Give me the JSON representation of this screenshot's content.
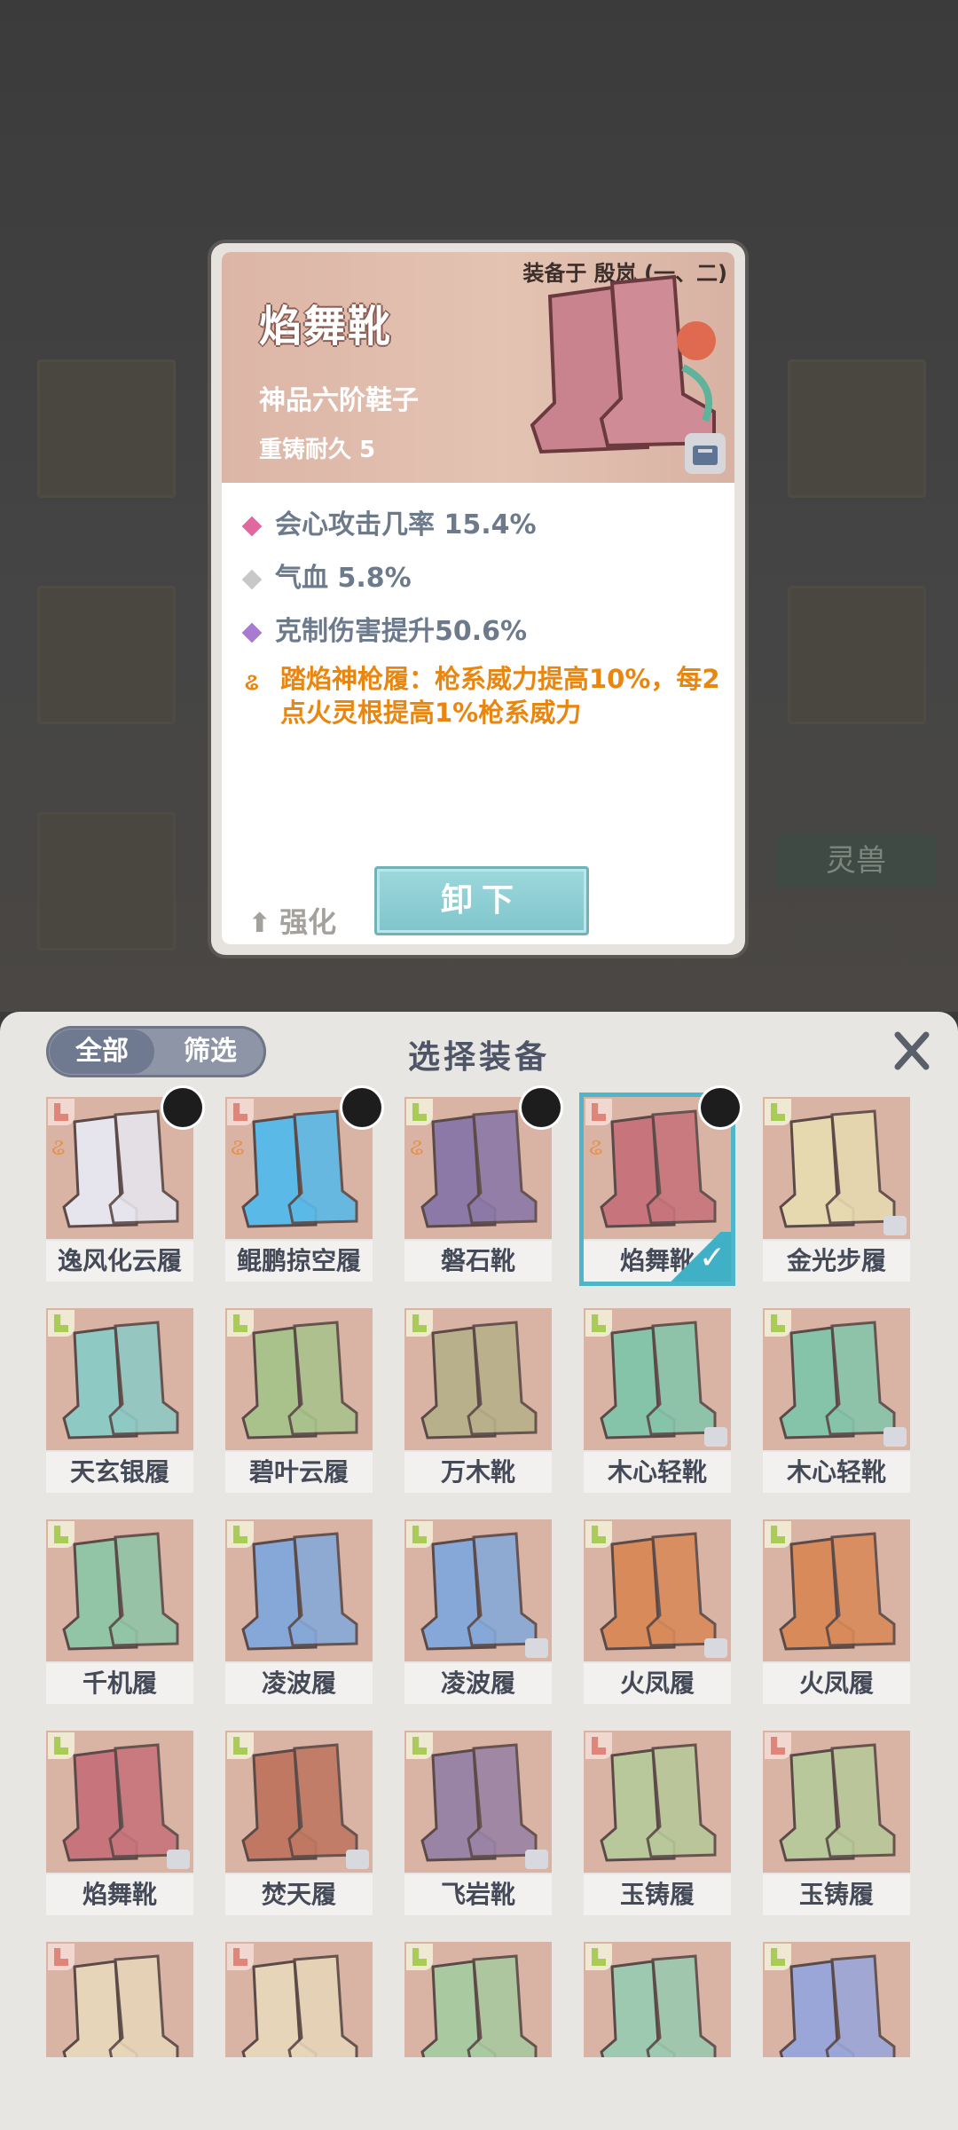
{
  "detail": {
    "equipped_text": "装备于 殷岚 (一、二)",
    "name": "焰舞靴",
    "grade": "神品六阶鞋子",
    "recast": "重铸耐久 5",
    "stats": [
      {
        "text": "会心攻击几率 15.4%",
        "color": "#e0689f"
      },
      {
        "text": "气血 5.8%",
        "color": "#c8c8c8"
      },
      {
        "text": "克制伤害提升50.6%",
        "color": "#a87ad0"
      }
    ],
    "special_icon": "rare-mark-icon",
    "special_text": "踏焰神枪履：枪系威力提高10%，每2点火灵根提高1%枪系威力",
    "strengthen_label": "强化",
    "unequip_label": "卸下"
  },
  "background": {
    "pet_label": "灵兽"
  },
  "panel": {
    "filter_all": "全部",
    "filter_select": "筛选",
    "title": "选择装备",
    "close_icon": "close-icon"
  },
  "items": [
    {
      "name": "逸风化云履",
      "color": "#e6e4ec",
      "tag": "red",
      "rare": true,
      "face": true
    },
    {
      "name": "鲲鹏掠空履",
      "color": "#5bb9e8",
      "tag": "red",
      "rare": true,
      "face": true
    },
    {
      "name": "磐石靴",
      "color": "#8c79a8",
      "tag": "yellow",
      "rare": true,
      "face": true
    },
    {
      "name": "焰舞靴",
      "color": "#c8747c",
      "tag": "red",
      "rare": true,
      "face": true,
      "selected": true,
      "lock": true
    },
    {
      "name": "金光步履",
      "color": "#e6d9b0",
      "tag": "yellow",
      "lock": true
    },
    {
      "name": "天玄银履",
      "color": "#8fc9c4",
      "tag": "yellow"
    },
    {
      "name": "碧叶云履",
      "color": "#a9c28c",
      "tag": "yellow"
    },
    {
      "name": "万木靴",
      "color": "#b8b08a",
      "tag": "yellow"
    },
    {
      "name": "木心轻靴",
      "color": "#86c4aa",
      "tag": "yellow",
      "lock": true
    },
    {
      "name": "木心轻靴",
      "color": "#86c4aa",
      "tag": "yellow",
      "lock": true
    },
    {
      "name": "千机履",
      "color": "#92c4a6",
      "tag": "yellow"
    },
    {
      "name": "凌波履",
      "color": "#86a8d8",
      "tag": "yellow"
    },
    {
      "name": "凌波履",
      "color": "#86a8d8",
      "tag": "yellow",
      "lock": true
    },
    {
      "name": "火凤履",
      "color": "#d88a5a",
      "tag": "yellow",
      "lock": true
    },
    {
      "name": "火凤履",
      "color": "#d88a5a",
      "tag": "yellow"
    },
    {
      "name": "焰舞靴",
      "color": "#c8747c",
      "tag": "yellow",
      "lock": true
    },
    {
      "name": "焚天履",
      "color": "#c07862",
      "tag": "yellow",
      "lock": true
    },
    {
      "name": "飞岩靴",
      "color": "#9a84a6",
      "tag": "yellow",
      "lock": true
    },
    {
      "name": "玉铸履",
      "color": "#b8c89a",
      "tag": "red"
    },
    {
      "name": "玉铸履",
      "color": "#b8c89a",
      "tag": "red"
    },
    {
      "name": "",
      "color": "#e6d5b8",
      "tag": "red"
    },
    {
      "name": "",
      "color": "#e6d5b8",
      "tag": "red"
    },
    {
      "name": "",
      "color": "#a9c9a0",
      "tag": "yellow"
    },
    {
      "name": "",
      "color": "#9cc9b0",
      "tag": "yellow"
    },
    {
      "name": "",
      "color": "#9aa6d8",
      "tag": "yellow"
    }
  ]
}
